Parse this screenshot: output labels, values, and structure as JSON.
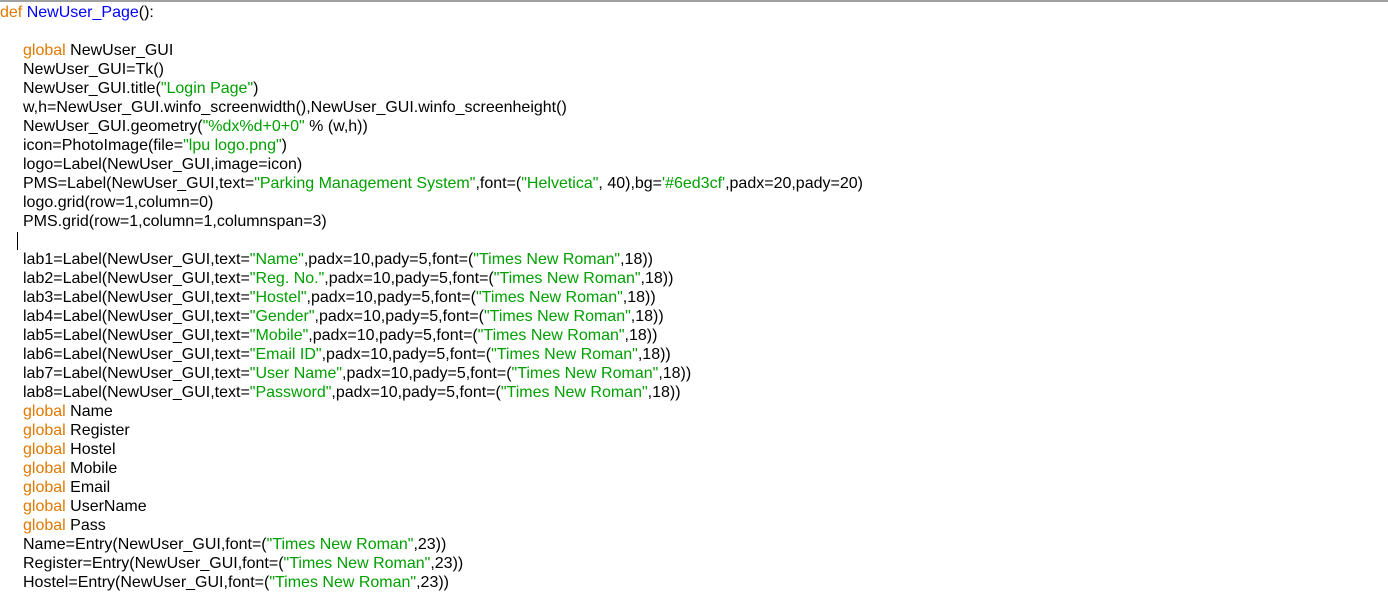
{
  "lines": [
    {
      "indent": false,
      "tokens": [
        {
          "t": "def",
          "c": "kw"
        },
        {
          "t": " ",
          "c": ""
        },
        {
          "t": "NewUser_Page",
          "c": "fn"
        },
        {
          "t": "():",
          "c": ""
        }
      ]
    },
    {
      "indent": true,
      "tokens": []
    },
    {
      "indent": true,
      "tokens": [
        {
          "t": "global",
          "c": "kw"
        },
        {
          "t": " NewUser_GUI",
          "c": ""
        }
      ]
    },
    {
      "indent": true,
      "tokens": [
        {
          "t": "NewUser_GUI=Tk()",
          "c": ""
        }
      ]
    },
    {
      "indent": true,
      "tokens": [
        {
          "t": "NewUser_GUI.title(",
          "c": ""
        },
        {
          "t": "\"Login Page\"",
          "c": "str"
        },
        {
          "t": ")",
          "c": ""
        }
      ]
    },
    {
      "indent": true,
      "tokens": [
        {
          "t": "w,h=NewUser_GUI.winfo_screenwidth(),NewUser_GUI.winfo_screenheight()",
          "c": ""
        }
      ]
    },
    {
      "indent": true,
      "tokens": [
        {
          "t": "NewUser_GUI.geometry(",
          "c": ""
        },
        {
          "t": "\"%dx%d+0+0\"",
          "c": "str"
        },
        {
          "t": " % (w,h))",
          "c": ""
        }
      ]
    },
    {
      "indent": true,
      "tokens": [
        {
          "t": "icon=PhotoImage(file=",
          "c": ""
        },
        {
          "t": "\"lpu logo.png\"",
          "c": "str"
        },
        {
          "t": ")",
          "c": ""
        }
      ]
    },
    {
      "indent": true,
      "tokens": [
        {
          "t": "logo=Label(NewUser_GUI,image=icon)",
          "c": ""
        }
      ]
    },
    {
      "indent": true,
      "tokens": [
        {
          "t": "PMS=Label(NewUser_GUI,text=",
          "c": ""
        },
        {
          "t": "\"Parking Management System\"",
          "c": "str"
        },
        {
          "t": ",font=(",
          "c": ""
        },
        {
          "t": "\"Helvetica\"",
          "c": "str"
        },
        {
          "t": ", 40),bg=",
          "c": ""
        },
        {
          "t": "'#6ed3cf'",
          "c": "str"
        },
        {
          "t": ",padx=20,pady=20)",
          "c": ""
        }
      ]
    },
    {
      "indent": true,
      "tokens": [
        {
          "t": "logo.grid(row=1,column=0)",
          "c": ""
        }
      ]
    },
    {
      "indent": true,
      "tokens": [
        {
          "t": "PMS.grid(row=1,column=1,columnspan=3)",
          "c": ""
        }
      ]
    },
    {
      "indent": true,
      "tokens": []
    },
    {
      "indent": true,
      "tokens": [
        {
          "t": "lab1=Label(NewUser_GUI,text=",
          "c": ""
        },
        {
          "t": "\"Name\"",
          "c": "str"
        },
        {
          "t": ",padx=10,pady=5,font=(",
          "c": ""
        },
        {
          "t": "\"Times New Roman\"",
          "c": "str"
        },
        {
          "t": ",18))",
          "c": ""
        }
      ]
    },
    {
      "indent": true,
      "tokens": [
        {
          "t": "lab2=Label(NewUser_GUI,text=",
          "c": ""
        },
        {
          "t": "\"Reg. No.\"",
          "c": "str"
        },
        {
          "t": ",padx=10,pady=5,font=(",
          "c": ""
        },
        {
          "t": "\"Times New Roman\"",
          "c": "str"
        },
        {
          "t": ",18))",
          "c": ""
        }
      ]
    },
    {
      "indent": true,
      "tokens": [
        {
          "t": "lab3=Label(NewUser_GUI,text=",
          "c": ""
        },
        {
          "t": "\"Hostel\"",
          "c": "str"
        },
        {
          "t": ",padx=10,pady=5,font=(",
          "c": ""
        },
        {
          "t": "\"Times New Roman\"",
          "c": "str"
        },
        {
          "t": ",18))",
          "c": ""
        }
      ]
    },
    {
      "indent": true,
      "tokens": [
        {
          "t": "lab4=Label(NewUser_GUI,text=",
          "c": ""
        },
        {
          "t": "\"Gender\"",
          "c": "str"
        },
        {
          "t": ",padx=10,pady=5,font=(",
          "c": ""
        },
        {
          "t": "\"Times New Roman\"",
          "c": "str"
        },
        {
          "t": ",18))",
          "c": ""
        }
      ]
    },
    {
      "indent": true,
      "tokens": [
        {
          "t": "lab5=Label(NewUser_GUI,text=",
          "c": ""
        },
        {
          "t": "\"Mobile\"",
          "c": "str"
        },
        {
          "t": ",padx=10,pady=5,font=(",
          "c": ""
        },
        {
          "t": "\"Times New Roman\"",
          "c": "str"
        },
        {
          "t": ",18))",
          "c": ""
        }
      ]
    },
    {
      "indent": true,
      "tokens": [
        {
          "t": "lab6=Label(NewUser_GUI,text=",
          "c": ""
        },
        {
          "t": "\"Email ID\"",
          "c": "str"
        },
        {
          "t": ",padx=10,pady=5,font=(",
          "c": ""
        },
        {
          "t": "\"Times New Roman\"",
          "c": "str"
        },
        {
          "t": ",18))",
          "c": ""
        }
      ]
    },
    {
      "indent": true,
      "tokens": [
        {
          "t": "lab7=Label(NewUser_GUI,text=",
          "c": ""
        },
        {
          "t": "\"User Name\"",
          "c": "str"
        },
        {
          "t": ",padx=10,pady=5,font=(",
          "c": ""
        },
        {
          "t": "\"Times New Roman\"",
          "c": "str"
        },
        {
          "t": ",18))",
          "c": ""
        }
      ]
    },
    {
      "indent": true,
      "tokens": [
        {
          "t": "lab8=Label(NewUser_GUI,text=",
          "c": ""
        },
        {
          "t": "\"Password\"",
          "c": "str"
        },
        {
          "t": ",padx=10,pady=5,font=(",
          "c": ""
        },
        {
          "t": "\"Times New Roman\"",
          "c": "str"
        },
        {
          "t": ",18))",
          "c": ""
        }
      ]
    },
    {
      "indent": true,
      "tokens": [
        {
          "t": "global",
          "c": "kw"
        },
        {
          "t": " Name",
          "c": ""
        }
      ]
    },
    {
      "indent": true,
      "tokens": [
        {
          "t": "global",
          "c": "kw"
        },
        {
          "t": " Register",
          "c": ""
        }
      ]
    },
    {
      "indent": true,
      "tokens": [
        {
          "t": "global",
          "c": "kw"
        },
        {
          "t": " Hostel",
          "c": ""
        }
      ]
    },
    {
      "indent": true,
      "tokens": [
        {
          "t": "global",
          "c": "kw"
        },
        {
          "t": " Mobile",
          "c": ""
        }
      ]
    },
    {
      "indent": true,
      "tokens": [
        {
          "t": "global",
          "c": "kw"
        },
        {
          "t": " Email",
          "c": ""
        }
      ]
    },
    {
      "indent": true,
      "tokens": [
        {
          "t": "global",
          "c": "kw"
        },
        {
          "t": " UserName",
          "c": ""
        }
      ]
    },
    {
      "indent": true,
      "tokens": [
        {
          "t": "global",
          "c": "kw"
        },
        {
          "t": " Pass",
          "c": ""
        }
      ]
    },
    {
      "indent": true,
      "tokens": [
        {
          "t": "Name=Entry(NewUser_GUI,font=(",
          "c": ""
        },
        {
          "t": "\"Times New Roman\"",
          "c": "str"
        },
        {
          "t": ",23))",
          "c": ""
        }
      ]
    },
    {
      "indent": true,
      "tokens": [
        {
          "t": "Register=Entry(NewUser_GUI,font=(",
          "c": ""
        },
        {
          "t": "\"Times New Roman\"",
          "c": "str"
        },
        {
          "t": ",23))",
          "c": ""
        }
      ]
    },
    {
      "indent": true,
      "tokens": [
        {
          "t": "Hostel=Entry(NewUser_GUI,font=(",
          "c": ""
        },
        {
          "t": "\"Times New Roman\"",
          "c": "str"
        },
        {
          "t": ",23))",
          "c": ""
        }
      ]
    }
  ]
}
